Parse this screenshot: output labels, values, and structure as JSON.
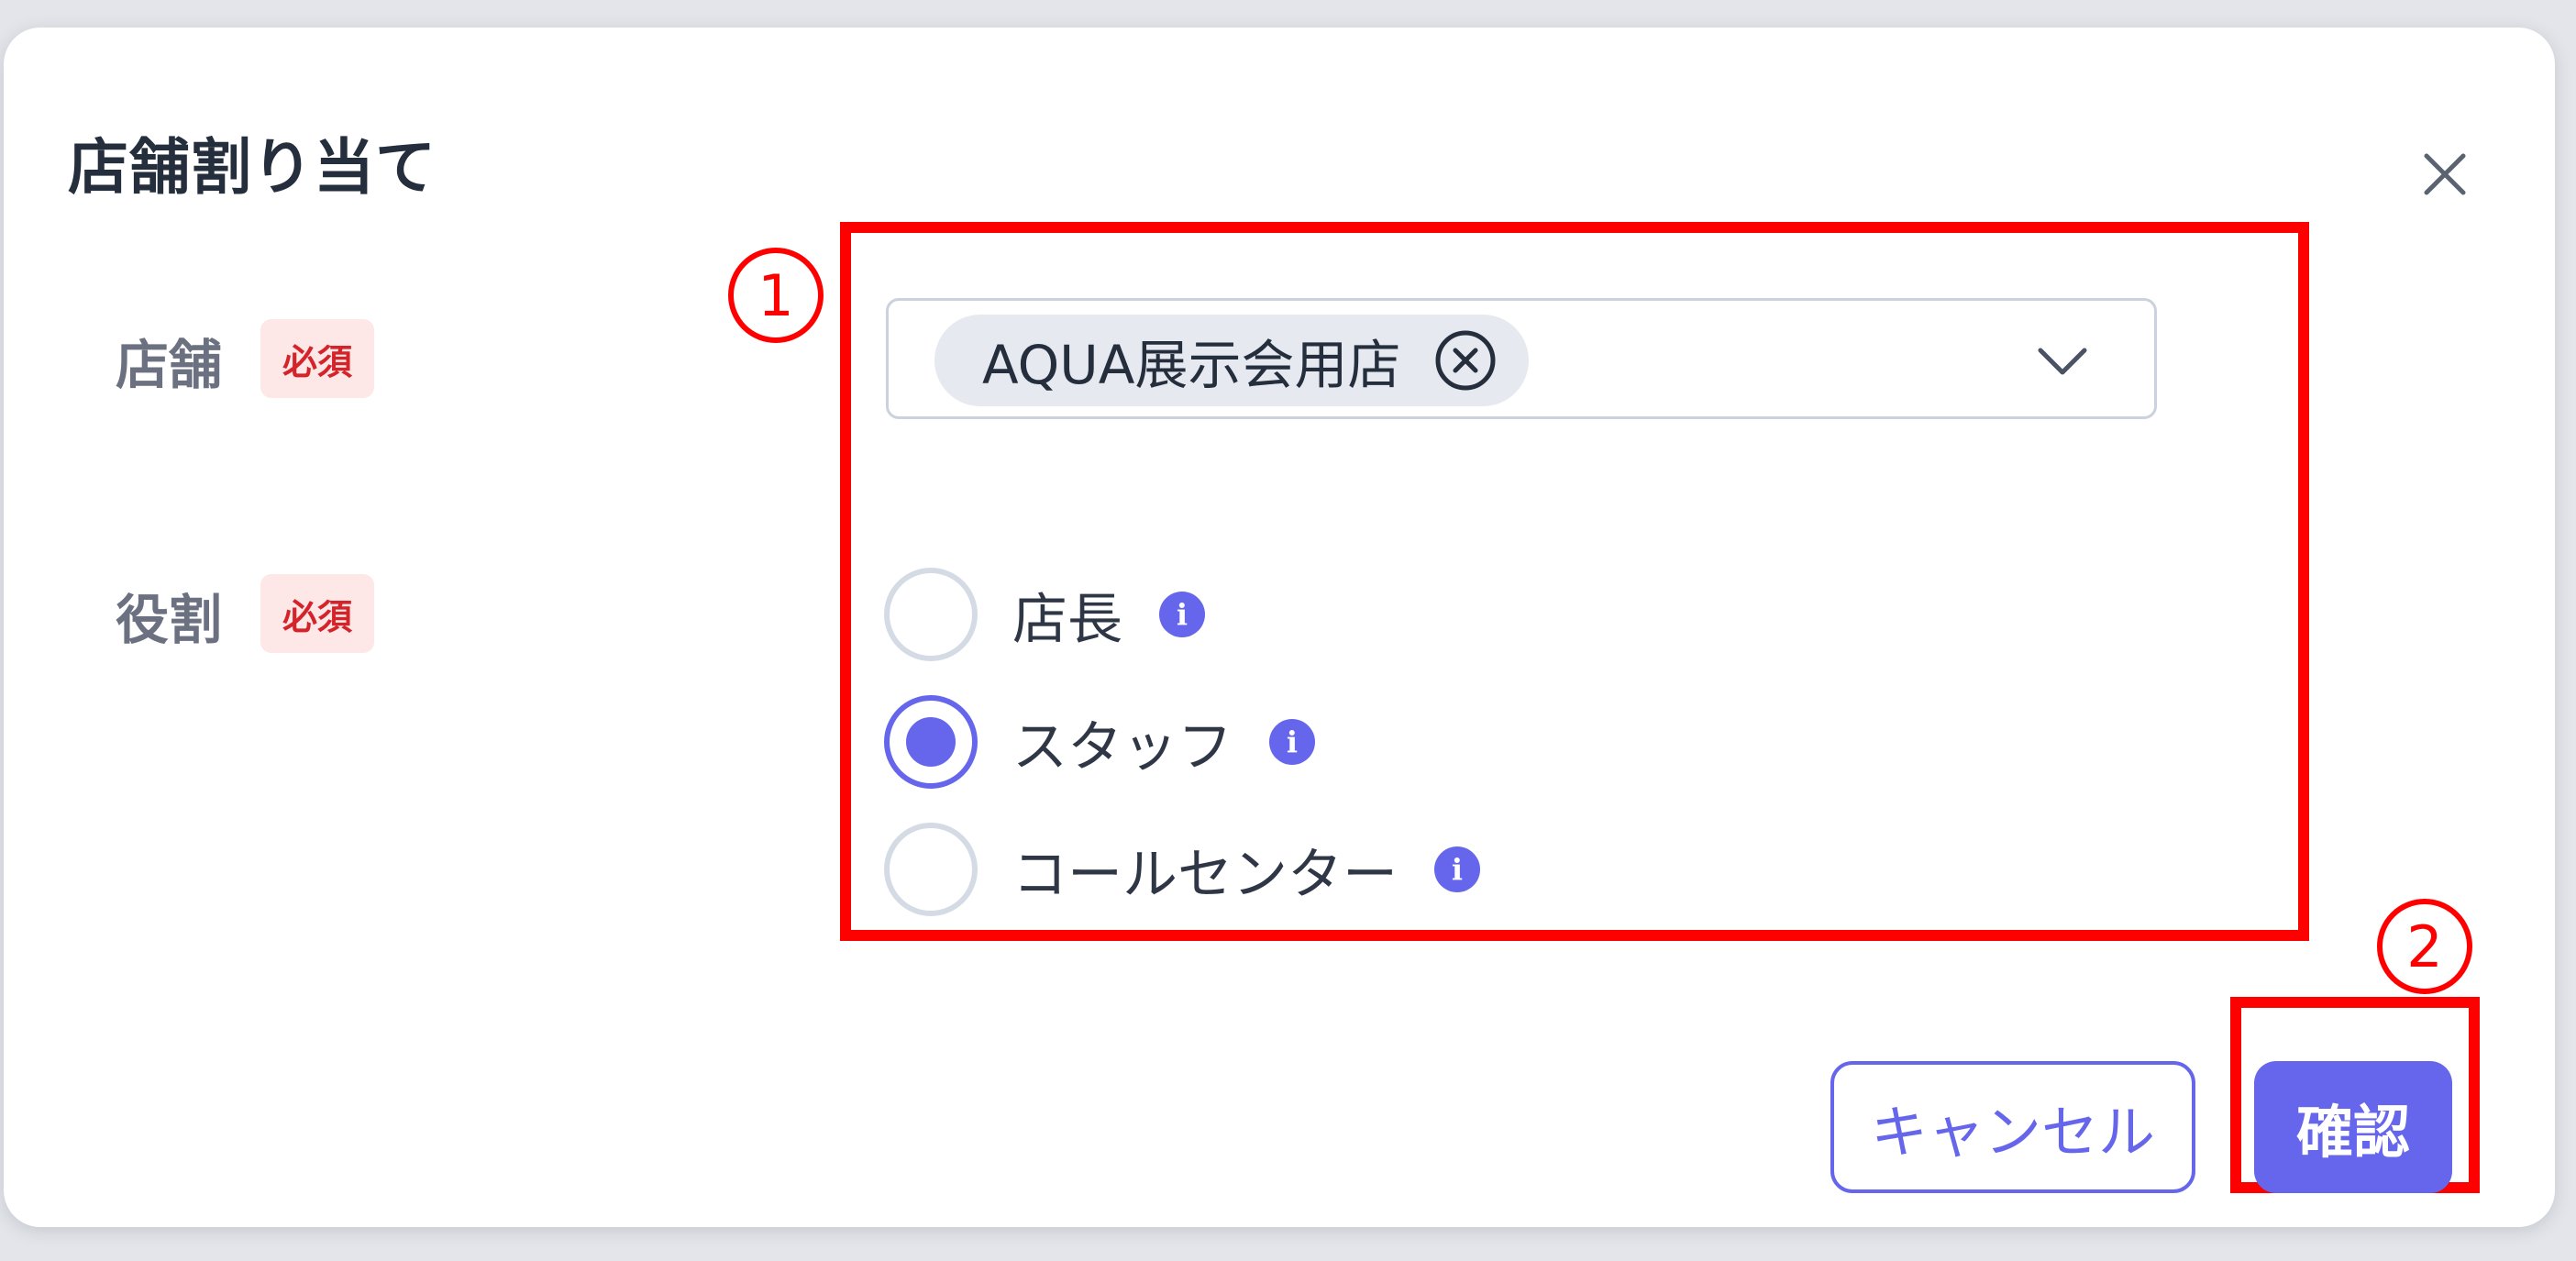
{
  "dialog": {
    "title": "店舗割り当て"
  },
  "fields": {
    "store": {
      "label": "店舗",
      "required_badge": "必須",
      "selected_chip": "AQUA展示会用店"
    },
    "role": {
      "label": "役割",
      "required_badge": "必須",
      "options": [
        {
          "label": "店長",
          "checked": false
        },
        {
          "label": "スタッフ",
          "checked": true
        },
        {
          "label": "コールセンター",
          "checked": false
        }
      ]
    }
  },
  "footer": {
    "cancel_label": "キャンセル",
    "confirm_label": "確認"
  },
  "annotations": {
    "marker_1": "1",
    "marker_2": "2"
  },
  "icons": {
    "close": "close-icon",
    "chip_remove": "circle-x-icon",
    "dropdown": "chevron-down-icon",
    "info": "info-icon"
  },
  "colors": {
    "accent": "#6566ec",
    "required_bg": "#fde7e7",
    "required_text": "#d4242a",
    "annotation": "#ff0000",
    "title_text": "#252e3c"
  }
}
